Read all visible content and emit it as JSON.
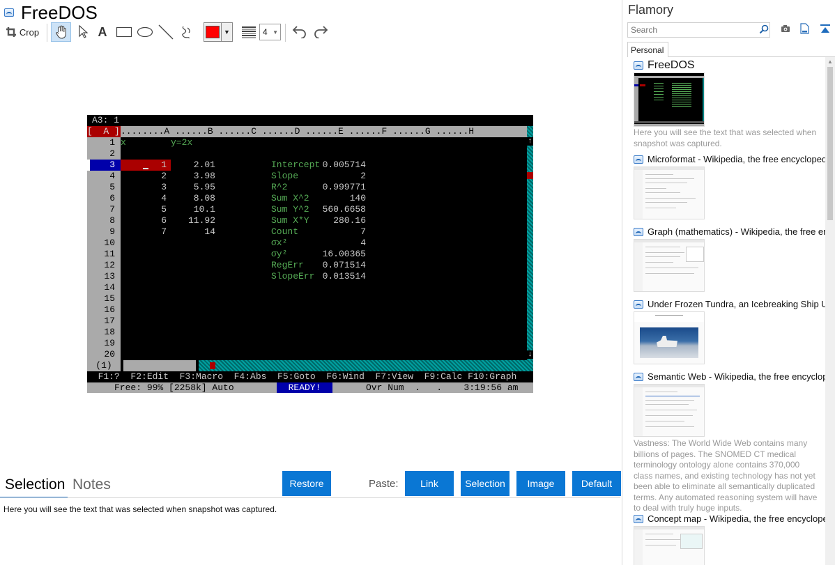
{
  "app": {
    "title": "FreeDOS"
  },
  "toolbar": {
    "crop_label": "Crop",
    "line_width": "4",
    "color": "#ff0000"
  },
  "dos": {
    "cell_ref": "A3: 1",
    "col_sel": "[  A ]",
    "col_header": "........A ......B ......C ......D ......E ......F ......G ......H",
    "rows": [
      "1",
      "2",
      "3",
      "4",
      "5",
      "6",
      "7",
      "8",
      "9",
      "10",
      "11",
      "12",
      "13",
      "14",
      "15",
      "16",
      "17",
      "18",
      "19",
      "20"
    ],
    "col_a": [
      "x",
      "",
      "1",
      "2",
      "3",
      "4",
      "5",
      "6",
      "7"
    ],
    "col_b": [
      "y=2x",
      "",
      "2.01",
      "3.98",
      "5.95",
      "8.08",
      "10.1",
      "11.92",
      "14"
    ],
    "stats_labels": [
      "Intercept",
      "Slope",
      "R^2",
      "Sum X^2",
      "Sum Y^2",
      "Sum X*Y",
      "Count",
      "σx²",
      "σy²",
      "RegErr",
      "SlopeErr"
    ],
    "stats_values": [
      "0.005714",
      "2",
      "0.999771",
      "140",
      "560.6658",
      "280.16",
      "7",
      "4",
      "16.00365",
      "0.071514",
      "0.013514"
    ],
    "hbar_rownum": "(1)",
    "fkeys": "  F1:?  F2:Edit  F3:Macro  F4:Abs  F5:Goto  F6:Wind  F7:View  F9:Calc F10:Graph",
    "status_left": "     Free: 99% [2258k] Auto",
    "status_ready": "READY!",
    "status_right": "Ovr Num  .   .    3:19:56 am"
  },
  "bottom": {
    "tab_selection": "Selection",
    "tab_notes": "Notes",
    "restore": "Restore",
    "paste_label": "Paste:",
    "link": "Link",
    "selection": "Selection",
    "image": "Image",
    "default": "Default",
    "selection_text": "Here you will see the text that was selected when snapshot was captured."
  },
  "flamory": {
    "title": "Flamory",
    "search_placeholder": "Search",
    "tab_personal": "Personal",
    "entries": [
      {
        "title": "FreeDOS",
        "desc": "Here you will see the text that was selected when snapshot was captured."
      },
      {
        "title": "Microformat - Wikipedia, the free encyclopedia",
        "desc": ""
      },
      {
        "title": "Graph (mathematics) - Wikipedia, the free encyclopedia",
        "desc": ""
      },
      {
        "title": "Under Frozen Tundra, an Icebreaking Ship Uncovers",
        "desc": ""
      },
      {
        "title": "Semantic Web - Wikipedia, the free encyclopedia",
        "desc": "Vastness: The World Wide Web contains many billions of pages. The SNOMED CT medical terminology ontology alone contains 370,000 class names, and existing technology has not yet been able to eliminate all semantically duplicated terms. Any automated reasoning system will have to deal with truly huge inputs."
      },
      {
        "title": "Concept map - Wikipedia, the free encyclopedia",
        "desc": ""
      }
    ]
  }
}
